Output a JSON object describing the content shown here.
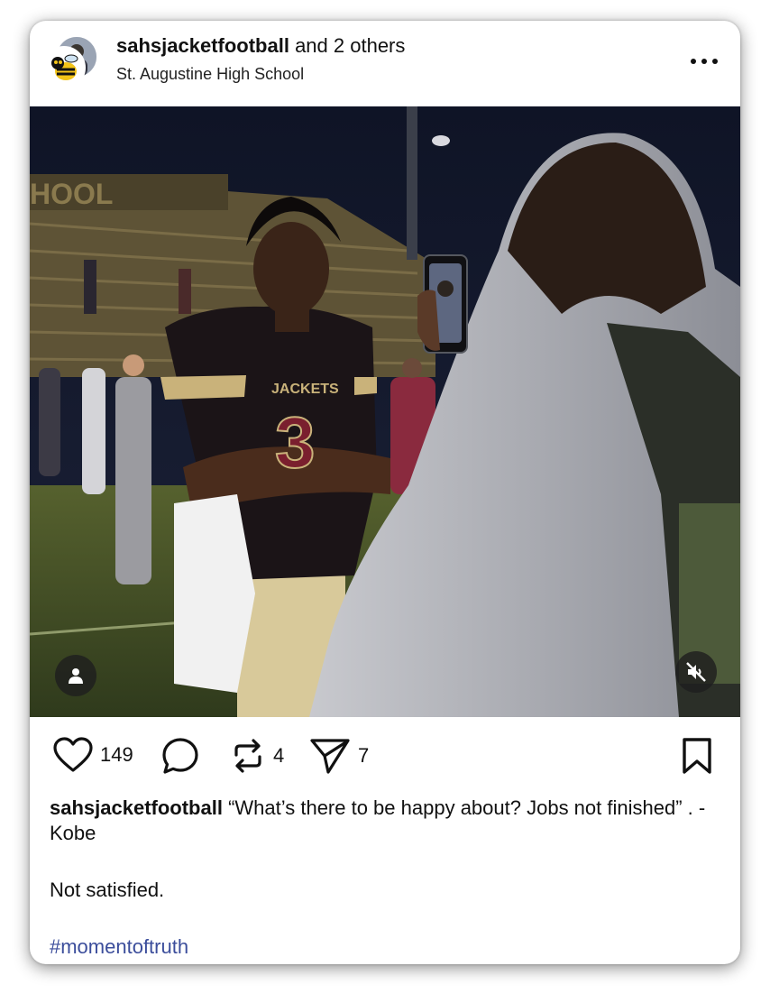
{
  "header": {
    "username": "sahsjacketfootball",
    "collab_suffix": " and 2 others",
    "location": "St. Augustine High School",
    "more_icon": "more-horizontal-icon"
  },
  "photo": {
    "stadium_sign": "HOOL",
    "jersey_text": "JACKETS",
    "jersey_number": "3",
    "tag_icon": "user-tag-icon",
    "mute_icon": "speaker-muted-icon"
  },
  "actions": {
    "like_count": "149",
    "repost_count": "4",
    "share_count": "7",
    "icons": [
      "heart-icon",
      "comment-icon",
      "repost-icon",
      "share-icon",
      "bookmark-icon"
    ]
  },
  "caption": {
    "username": "sahsjacketfootball",
    "text": " “What’s there to be happy about? Jobs not finished” . - Kobe",
    "line2": "Not satisfied.",
    "hashtag": "#momentoftruth"
  },
  "colors": {
    "hashtag": "#3b4d9b",
    "jersey": "#1b1417",
    "gold": "#c9b27a",
    "maroon": "#7a1f2e"
  }
}
